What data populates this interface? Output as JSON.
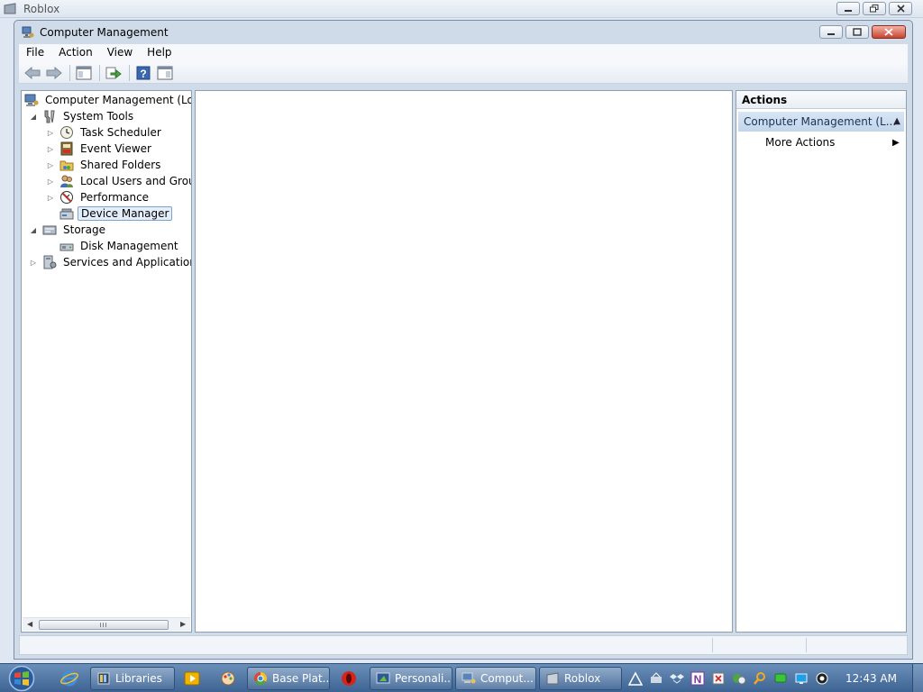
{
  "outer_window": {
    "title": "Roblox"
  },
  "window": {
    "title": "Computer Management",
    "menu": [
      "File",
      "Action",
      "View",
      "Help"
    ]
  },
  "tree": {
    "root": "Computer Management (Local",
    "system_tools": "System Tools",
    "task_scheduler": "Task Scheduler",
    "event_viewer": "Event Viewer",
    "shared_folders": "Shared Folders",
    "local_users": "Local Users and Groups",
    "performance": "Performance",
    "device_manager": "Device Manager",
    "storage": "Storage",
    "disk_management": "Disk Management",
    "services": "Services and Applications",
    "scroll_grip": "III"
  },
  "actions": {
    "header": "Actions",
    "section": "Computer Management (L...",
    "more": "More Actions"
  },
  "taskbar": {
    "tasks": [
      "Libraries",
      "Base Plat...",
      "Personali...",
      "Comput...",
      "Roblox"
    ],
    "clock": "12:43 AM"
  },
  "colors": {
    "selection_border": "#7da2ce",
    "actions_section_bg": "#c3d5ec",
    "taskbar": "#4a6f9e"
  }
}
